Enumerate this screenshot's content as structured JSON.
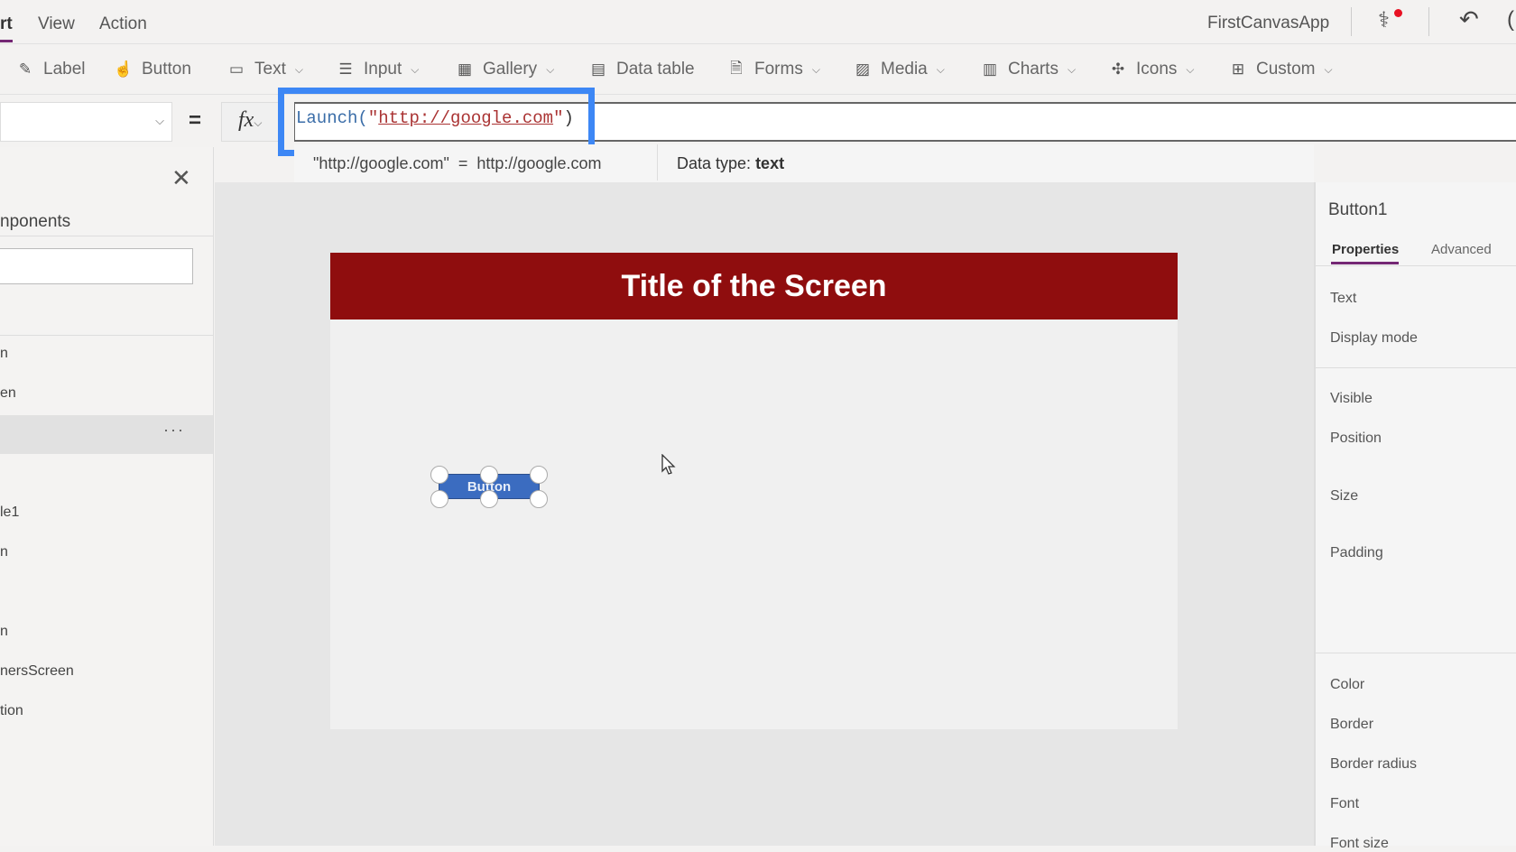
{
  "menu": {
    "items": [
      "rt",
      "View",
      "Action"
    ]
  },
  "app_title": "FirstCanvasApp",
  "toolbar": {
    "items": [
      {
        "label": "Label",
        "icon": "edit-label-icon",
        "dropdown": false
      },
      {
        "label": "Button",
        "icon": "button-touch-icon",
        "dropdown": false
      },
      {
        "label": "Text",
        "icon": "text-abc-icon",
        "dropdown": true
      },
      {
        "label": "Input",
        "icon": "sliders-icon",
        "dropdown": true
      },
      {
        "label": "Gallery",
        "icon": "gallery-grid-icon",
        "dropdown": true
      },
      {
        "label": "Data table",
        "icon": "table-icon",
        "dropdown": false
      },
      {
        "label": "Forms",
        "icon": "form-icon",
        "dropdown": true
      },
      {
        "label": "Media",
        "icon": "image-icon",
        "dropdown": true
      },
      {
        "label": "Charts",
        "icon": "bar-chart-icon",
        "dropdown": true
      },
      {
        "label": "Icons",
        "icon": "icons-icon",
        "dropdown": true
      },
      {
        "label": "Custom",
        "icon": "custom-blocks-icon",
        "dropdown": true
      }
    ]
  },
  "formula": {
    "equals": "=",
    "fx": "fx",
    "fn": "Launch(",
    "quote_open": "\"",
    "url": "http://google.com",
    "quote_close": "\"",
    "close": ")",
    "highlight_color": "#3d87f5"
  },
  "result": {
    "expr": "\"http://google.com\"  =  http://google.com",
    "type_label": "Data type:",
    "type_value": "text"
  },
  "left_panel": {
    "heading": "nponents",
    "items": [
      "n",
      "en",
      "",
      "le1",
      "n",
      "n",
      "nersScreen",
      "tion"
    ],
    "more": "···"
  },
  "canvas": {
    "title": "Title of the Screen",
    "title_color": "#8f0d0e",
    "button_label": "Button",
    "button_color": "#3b6cc0"
  },
  "right_panel": {
    "control": "Button1",
    "tabs": [
      "Properties",
      "Advanced"
    ],
    "active_tab": "Properties",
    "props": [
      "Text",
      "Display mode",
      "Visible",
      "Position",
      "Size",
      "Padding",
      "Color",
      "Border",
      "Border radius",
      "Font",
      "Font size"
    ]
  }
}
